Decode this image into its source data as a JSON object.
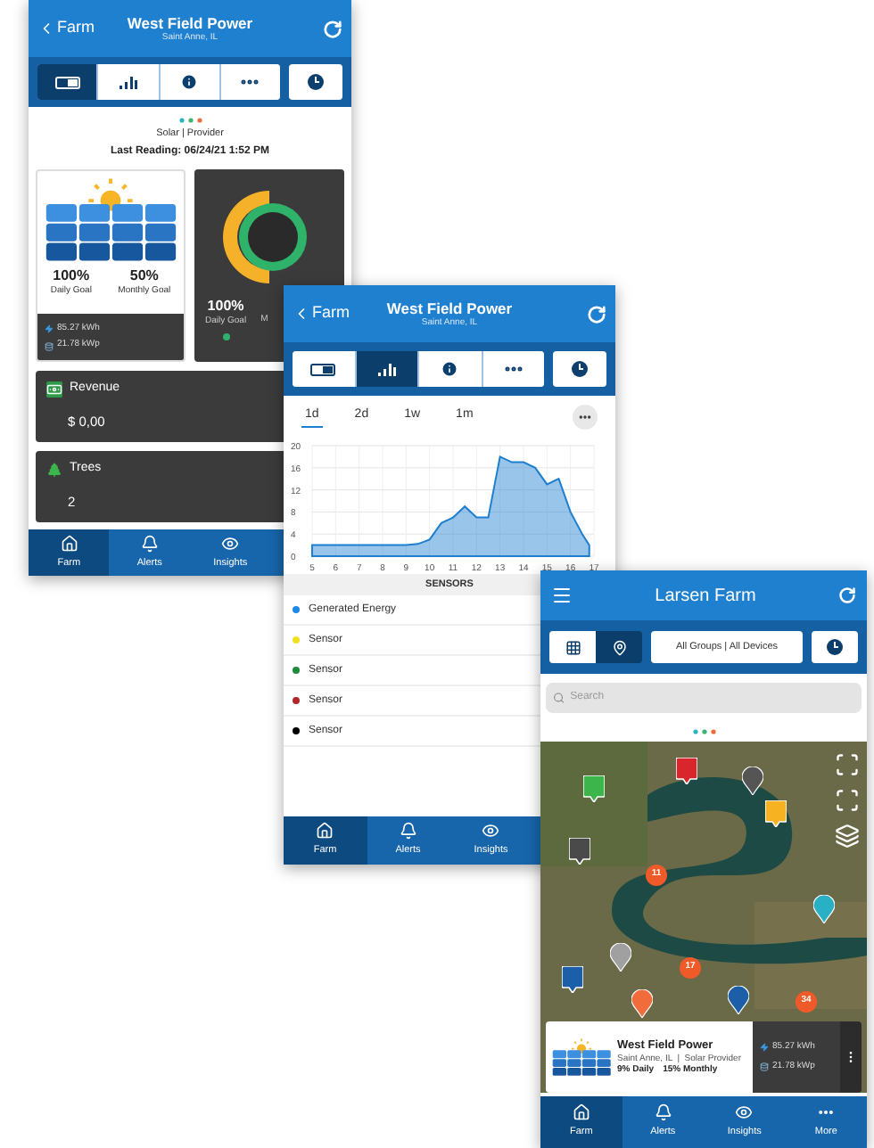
{
  "farm_screen": {
    "header": {
      "back": "Farm",
      "title": "West Field Power",
      "subtitle": "Saint Anne, IL"
    },
    "tabs": [
      {
        "selected": true
      },
      {
        "selected": false
      },
      {
        "selected": false
      },
      {
        "selected": false
      },
      {
        "selected": false
      }
    ],
    "meta": "Solar | Provider",
    "last_reading": "Last Reading: 06/24/21 1:52 PM",
    "goal_card": {
      "daily": "100%",
      "daily_label": "Daily Goal",
      "monthly": "50%",
      "monthly_label": "Monthly Goal",
      "energy": "85.27 kWh",
      "power": "21.78 kWp"
    },
    "donut_card": {
      "value": "100%",
      "label": "Daily Goal",
      "label_2": "M",
      "status": {
        "color": "#2fb36a"
      }
    },
    "revenue": {
      "title": "Revenue",
      "value": "$ 0,00"
    },
    "trees": {
      "title": "Trees",
      "value": "2"
    },
    "nav": [
      {
        "label": "Farm",
        "selected": true
      },
      {
        "label": "Alerts",
        "selected": false
      },
      {
        "label": "Insights",
        "selected": false
      }
    ]
  },
  "chart_screen": {
    "header": {
      "back": "Farm",
      "title": "West Field Power",
      "subtitle": "Saint Anne, IL"
    },
    "tabs": [
      {
        "selected": false
      },
      {
        "selected": true
      },
      {
        "selected": false
      },
      {
        "selected": false
      },
      {
        "selected": false
      }
    ],
    "ranges": [
      {
        "label": "1d",
        "selected": true
      },
      {
        "label": "2d",
        "selected": false
      },
      {
        "label": "1w",
        "selected": false
      },
      {
        "label": "1m",
        "selected": false
      }
    ],
    "chart_data": {
      "type": "area",
      "x": [
        5,
        5.5,
        6,
        6.5,
        7,
        7.5,
        8,
        8.5,
        9,
        9.5,
        10,
        10.5,
        11,
        11.5,
        12,
        12.5,
        13,
        13.5,
        14,
        14.5,
        15,
        15.5,
        16,
        16.5,
        16.8
      ],
      "grid": true,
      "series": [
        {
          "color": "#1e7fd0",
          "values": [
            2,
            2,
            2,
            2,
            2,
            2,
            2,
            2,
            2,
            2.2,
            3,
            6,
            7,
            9,
            7,
            7,
            18,
            17,
            17,
            16,
            13,
            14,
            8,
            4,
            2
          ]
        }
      ],
      "xlim": [
        5,
        17
      ],
      "ylim": [
        0,
        20
      ],
      "xticks": [
        5,
        6,
        7,
        8,
        9,
        10,
        11,
        12,
        13,
        14,
        15,
        16,
        17
      ],
      "yticks": [
        0,
        4,
        8,
        12,
        16,
        20
      ]
    },
    "sensors_title": "SENSORS",
    "sensors": [
      {
        "name": "Generated Energy",
        "color": "#1e88e5"
      },
      {
        "name": "Sensor",
        "color": "#f0e020"
      },
      {
        "name": "Sensor",
        "color": "#1e8c3a"
      },
      {
        "name": "Sensor",
        "color": "#b3262b"
      },
      {
        "name": "Sensor",
        "color": "#000000"
      }
    ],
    "nav": [
      {
        "label": "Farm",
        "selected": true
      },
      {
        "label": "Alerts",
        "selected": false
      },
      {
        "label": "Insights",
        "selected": false
      }
    ]
  },
  "map_screen": {
    "title": "Larsen Farm",
    "views": [
      {
        "selected": false
      },
      {
        "selected": true
      }
    ],
    "filter": "All Groups | All Devices",
    "search": {
      "placeholder": "Search"
    },
    "pins": [
      {
        "kind": "square",
        "color": "#3cb54a"
      },
      {
        "kind": "square",
        "color": "#d8262c"
      },
      {
        "kind": "round",
        "color": "#555555"
      },
      {
        "kind": "square",
        "color": "#f6b221"
      },
      {
        "kind": "square",
        "color": "#4a4a4a"
      },
      {
        "kind": "count",
        "color": "#f05a28",
        "label": "11"
      },
      {
        "kind": "round",
        "color": "#2ab0c5"
      },
      {
        "kind": "round",
        "color": "#a0a0a0"
      },
      {
        "kind": "square",
        "color": "#1c5fa8"
      },
      {
        "kind": "count",
        "color": "#f05a28",
        "label": "17"
      },
      {
        "kind": "round",
        "color": "#f26b3a"
      },
      {
        "kind": "round",
        "color": "#1c5fa8"
      },
      {
        "kind": "count",
        "color": "#f05a28",
        "label": "34"
      }
    ],
    "card": {
      "title": "West Field Power",
      "subtitle": "Saint Anne, IL  |  Solar Provider",
      "daily": "9% Daily",
      "monthly": "15% Monthly",
      "energy": "85.27 kWh",
      "power": "21.78 kWp"
    },
    "nav": [
      {
        "label": "Farm",
        "selected": true
      },
      {
        "label": "Alerts",
        "selected": false
      },
      {
        "label": "Insights",
        "selected": false
      },
      {
        "label": "More",
        "selected": false
      }
    ]
  }
}
